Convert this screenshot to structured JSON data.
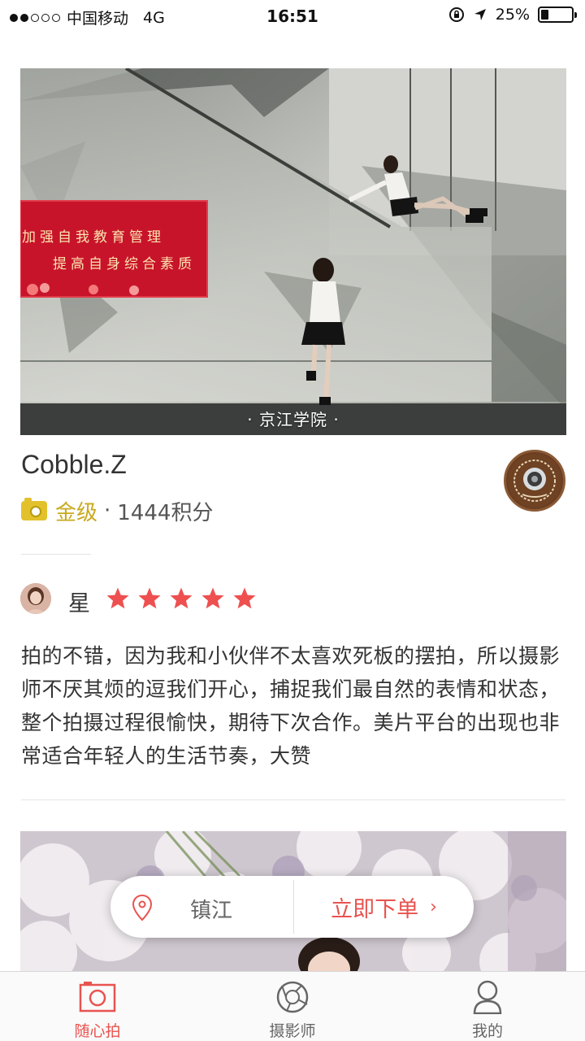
{
  "status_bar": {
    "carrier": "中国移动",
    "network": "4G",
    "time": "16:51",
    "battery": "25%",
    "battery_level": 0.25
  },
  "photo": {
    "caption": "· 京江学院 ·",
    "sign_line1": "加强自我教育管理",
    "sign_line2": "提高自身综合素质"
  },
  "photographer": {
    "name": "Cobble.Z",
    "level": "金级",
    "separator": "·",
    "points": "1444积分"
  },
  "review": {
    "reviewer": "星",
    "rating": 5,
    "text": "拍的不错，因为我和小伙伴不太喜欢死板的摆拍，所以摄影师不厌其烦的逗我们开心，捕捉我们最自然的表情和状态，整个拍摄过程很愉快，期待下次合作。美片平台的出现也非常适合年轻人的生活节奏，大赞"
  },
  "action_bar": {
    "location": "镇江",
    "order_label": "立即下单",
    "chevron": "›"
  },
  "tabs": [
    {
      "label": "随心拍",
      "icon": "camera-icon",
      "active": true
    },
    {
      "label": "摄影师",
      "icon": "aperture-icon",
      "active": false
    },
    {
      "label": "我的",
      "icon": "person-icon",
      "active": false
    }
  ],
  "colors": {
    "accent": "#e8534f",
    "gold": "#c9a91e",
    "star": "#ee5050"
  }
}
